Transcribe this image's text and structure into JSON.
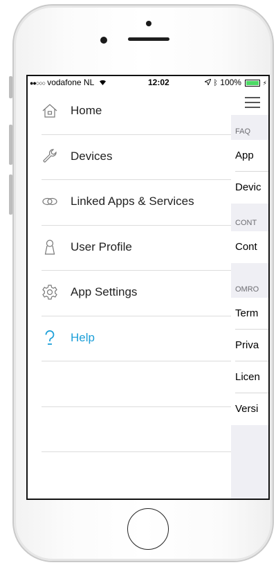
{
  "status_bar": {
    "signal_dots": "●●○○○",
    "carrier": "vodafone NL",
    "time": "12:02",
    "battery": "100%",
    "battery_level": 1.0
  },
  "menu": {
    "items": [
      {
        "label": "Home",
        "icon": "home-icon"
      },
      {
        "label": "Devices",
        "icon": "wrench-icon"
      },
      {
        "label": "Linked Apps & Services",
        "icon": "link-icon"
      },
      {
        "label": "User Profile",
        "icon": "user-icon"
      },
      {
        "label": "App Settings",
        "icon": "gear-icon"
      },
      {
        "label": "Help",
        "icon": "question-icon",
        "active": true
      }
    ]
  },
  "right_panel": {
    "sections": [
      {
        "header": "FAQ",
        "cells": [
          "App",
          "Devic"
        ]
      },
      {
        "header": "CONT",
        "cells": [
          "Cont"
        ]
      },
      {
        "header": "OMRO",
        "cells": [
          "Term",
          "Priva",
          "Licen",
          "Versi"
        ]
      }
    ]
  },
  "colors": {
    "accent": "#1c9fd8",
    "battery": "#4cd964",
    "panel_bg": "#efeff4"
  }
}
